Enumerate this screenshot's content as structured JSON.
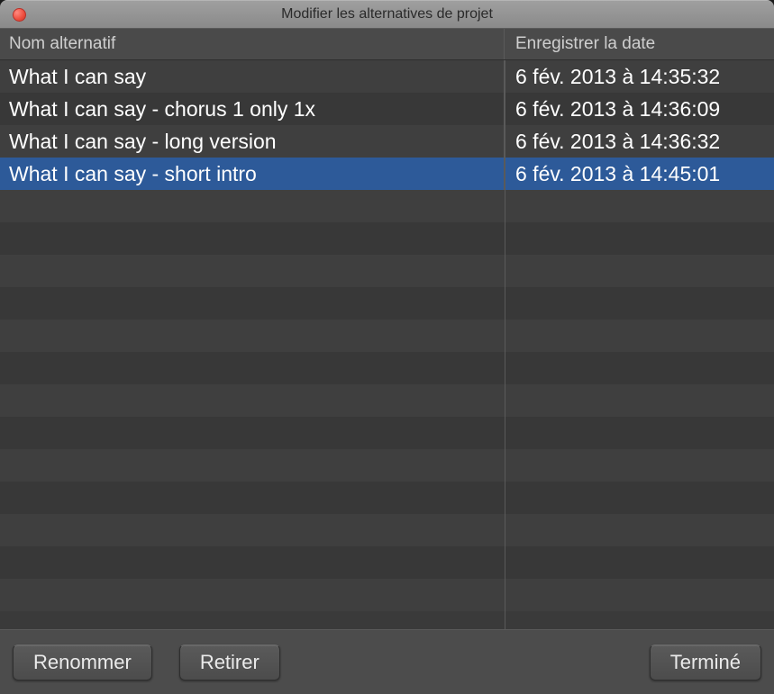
{
  "window": {
    "title": "Modifier les alternatives de projet"
  },
  "columns": {
    "name": "Nom alternatif",
    "date": "Enregistrer la date"
  },
  "rows": [
    {
      "name": "What I can say",
      "date": "6 fév. 2013 à 14:35:32",
      "selected": false
    },
    {
      "name": "What I can say - chorus 1 only 1x",
      "date": "6 fév. 2013 à 14:36:09",
      "selected": false
    },
    {
      "name": "What I can say - long version",
      "date": "6 fév. 2013 à 14:36:32",
      "selected": false
    },
    {
      "name": "What I can say - short intro",
      "date": "6 fév. 2013 à 14:45:01",
      "selected": true
    }
  ],
  "buttons": {
    "rename": "Renommer",
    "remove": "Retirer",
    "done": "Terminé"
  }
}
